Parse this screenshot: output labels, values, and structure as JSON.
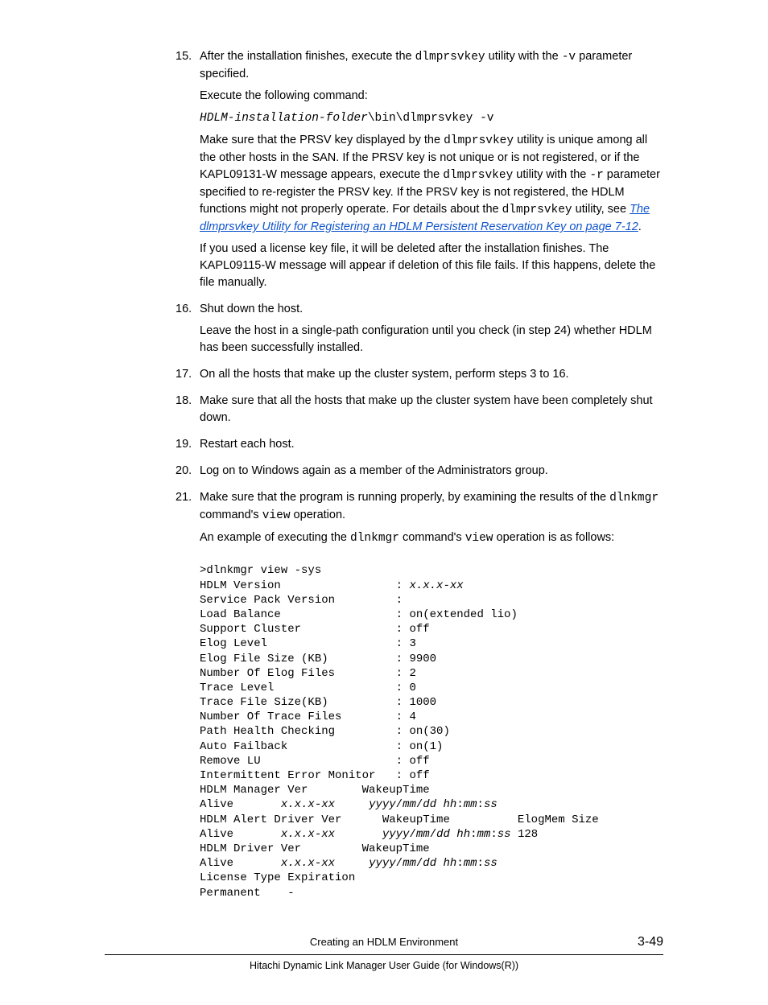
{
  "steps": {
    "s15": {
      "num": "15.",
      "p1a": "After the installation finishes, execute the ",
      "p1b": "dlmprsvkey",
      "p1c": " utility with the ",
      "p1d": "-v",
      "p1e": " parameter specified.",
      "p2": "Execute the following command:",
      "cmd_a": "HDLM-installation-folder",
      "cmd_b": "\\bin\\dlmprsvkey -v",
      "p3a": "Make sure that the PRSV key displayed by the ",
      "p3b": "dlmprsvkey",
      "p3c": " utility is unique among all the other hosts in the SAN. If the PRSV key is not unique or is not registered, or if the KAPL09131-W message appears, execute the ",
      "p3d": "dlmprsvkey",
      "p3e": " utility with the ",
      "p3f": "-r",
      "p3g": " parameter specified to re-register the PRSV key. If the PRSV key is not registered, the HDLM functions might not properly operate. For details about the ",
      "p3h": "dlmprsvkey",
      "p3i": " utility, see ",
      "link": "The dlmprsvkey Utility for Registering an HDLM Persistent Reservation Key on page 7-12",
      "p3j": ".",
      "p4": "If you used a license key file, it will be deleted after the installation finishes. The KAPL09115-W message will appear if deletion of this file fails. If this happens, delete the file manually."
    },
    "s16": {
      "num": "16.",
      "p1": "Shut down the host.",
      "p2": "Leave the host in a single-path configuration until you check (in step 24) whether HDLM has been successfully installed."
    },
    "s17": {
      "num": "17.",
      "p1": "On all the hosts that make up the cluster system, perform steps 3 to 16."
    },
    "s18": {
      "num": "18.",
      "p1": "Make sure that all the hosts that make up the cluster system have been completely shut down."
    },
    "s19": {
      "num": "19.",
      "p1": "Restart each host."
    },
    "s20": {
      "num": "20.",
      "p1": "Log on to Windows again as a member of the Administrators group."
    },
    "s21": {
      "num": "21.",
      "p1a": "Make sure that the program is running properly, by examining the results of the ",
      "p1b": "dlnkmgr",
      "p1c": " command's ",
      "p1d": "view",
      "p1e": " operation.",
      "p2a": "An example of executing the ",
      "p2b": "dlnkmgr",
      "p2c": " command's ",
      "p2d": "view",
      "p2e": " operation is as follows:"
    }
  },
  "code": {
    "l01": ">dlnkmgr view -sys",
    "l02a": "HDLM Version                 : ",
    "l02b": "x.x.x-xx",
    "l03": "Service Pack Version         : ",
    "l04": "Load Balance                 : on(extended lio)",
    "l05": "Support Cluster              : off",
    "l06": "Elog Level                   : 3",
    "l07": "Elog File Size (KB)          : 9900",
    "l08": "Number Of Elog Files         : 2",
    "l09": "Trace Level                  : 0",
    "l10": "Trace File Size(KB)          : 1000",
    "l11": "Number Of Trace Files        : 4",
    "l12": "Path Health Checking         : on(30)",
    "l13": "Auto Failback                : on(1)",
    "l14": "Remove LU                    : off",
    "l15": "Intermittent Error Monitor   : off",
    "l16": "HDLM Manager Ver        WakeupTime",
    "l17a": "Alive       ",
    "l17b": "x.x.x-xx",
    "l17c": "     ",
    "l17d": "yyyy",
    "l17e": "/",
    "l17f": "mm",
    "l17g": "/",
    "l17h": "dd hh",
    "l17i": ":",
    "l17j": "mm",
    "l17k": ":",
    "l17l": "ss",
    "l18": "HDLM Alert Driver Ver      WakeupTime          ElogMem Size",
    "l19a": "Alive       ",
    "l19b": "x.x.x-xx",
    "l19c": "       ",
    "l19d": "yyyy",
    "l19e": "/",
    "l19f": "mm",
    "l19g": "/",
    "l19h": "dd hh",
    "l19i": ":",
    "l19j": "mm",
    "l19k": ":",
    "l19l": "ss",
    "l19m": " 128",
    "l20": "HDLM Driver Ver         WakeupTime",
    "l21a": "Alive       ",
    "l21b": "x.x.x-xx",
    "l21c": "     ",
    "l21d": "yyyy",
    "l21e": "/",
    "l21f": "mm",
    "l21g": "/",
    "l21h": "dd hh",
    "l21i": ":",
    "l21j": "mm",
    "l21k": ":",
    "l21l": "ss",
    "l22": "License Type Expiration",
    "l23": "Permanent    -"
  },
  "footer": {
    "title": "Creating an HDLM Environment",
    "page": "3-49",
    "guide": "Hitachi Dynamic Link Manager User Guide (for Windows(R))"
  }
}
